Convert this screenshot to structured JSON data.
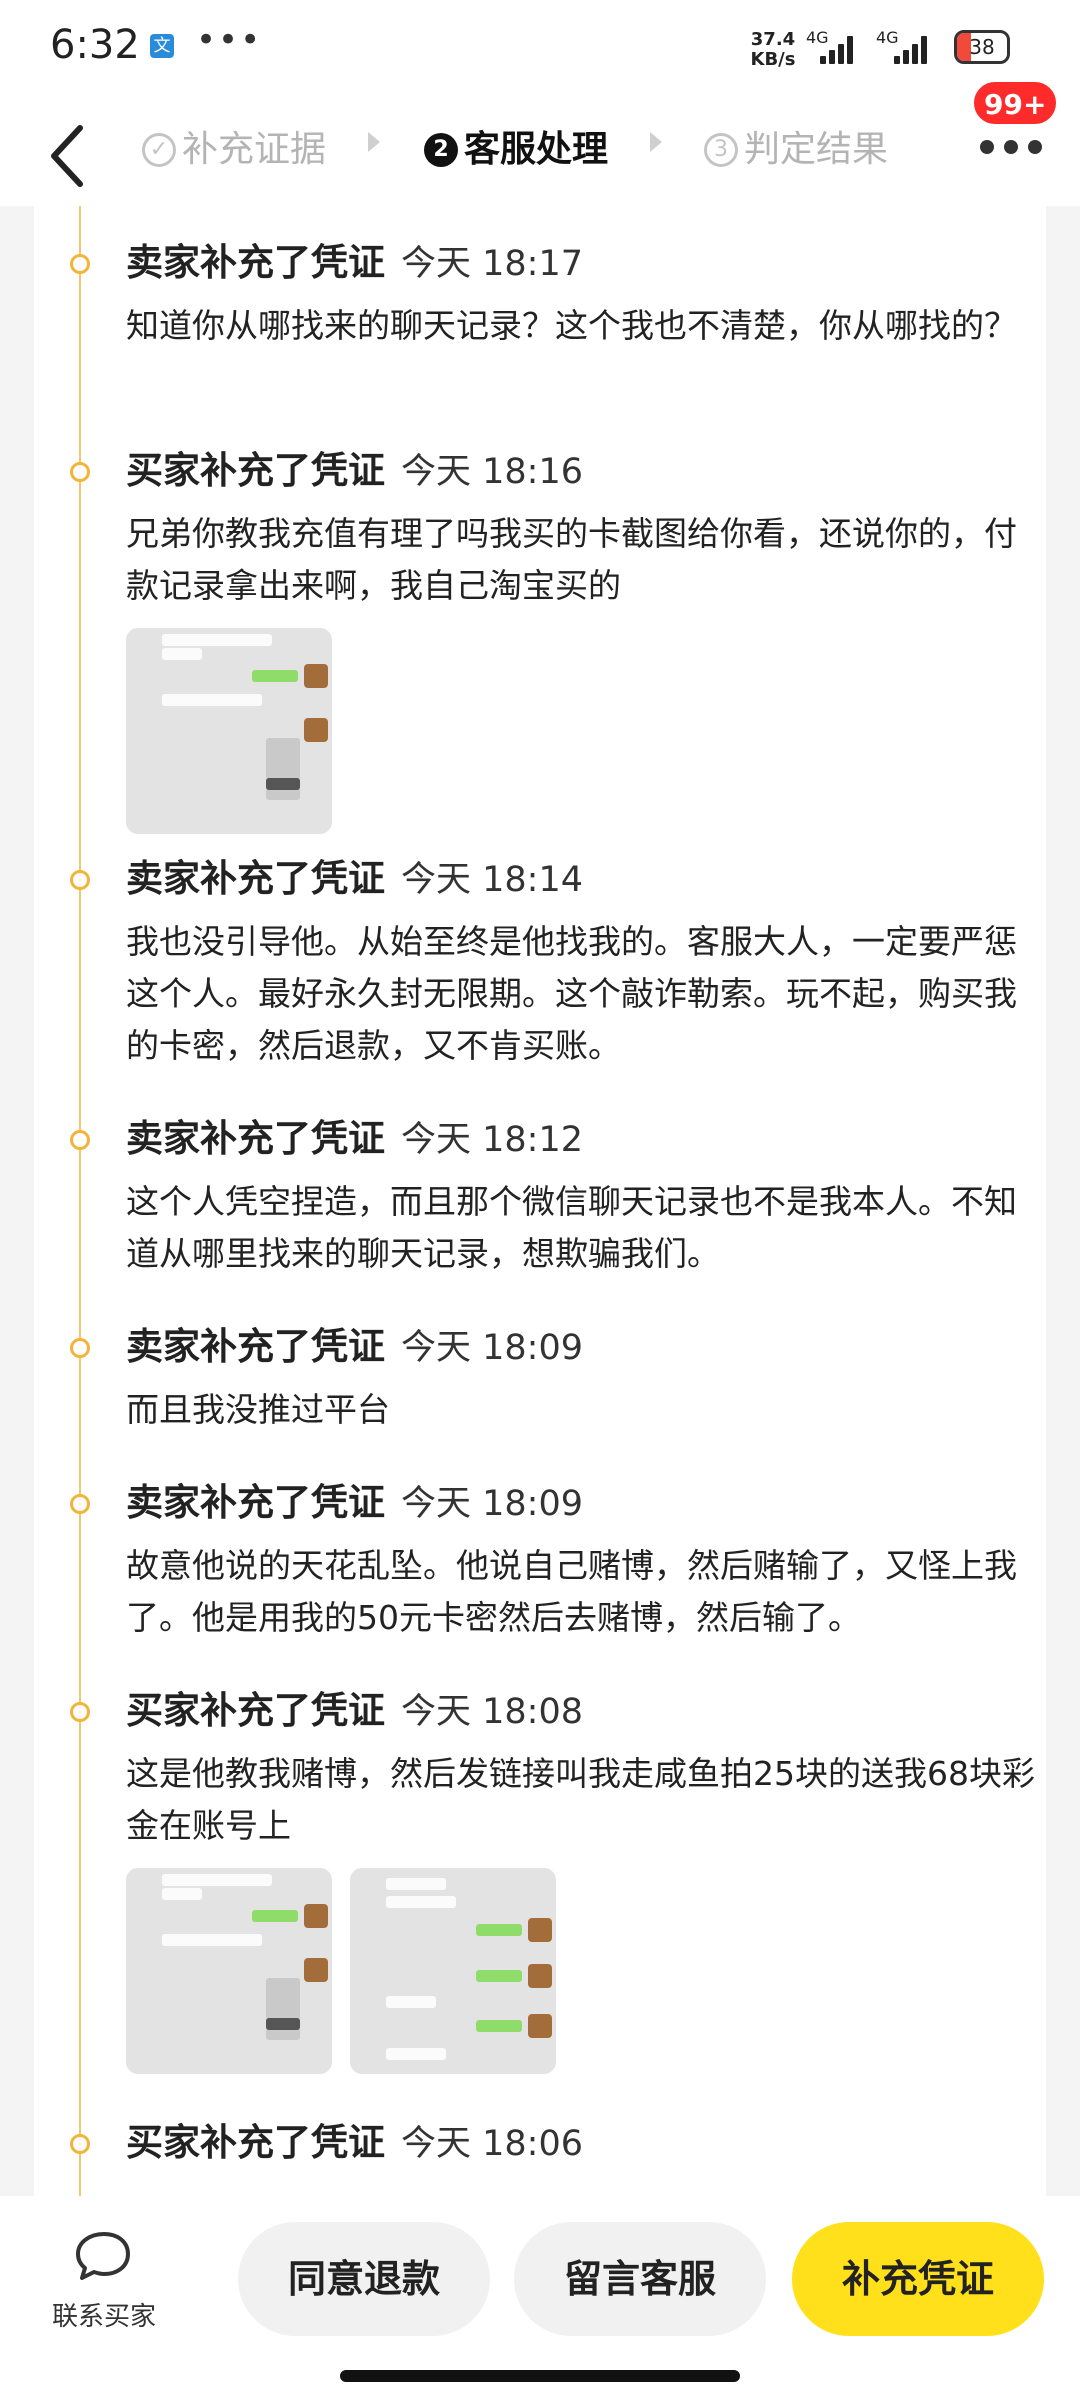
{
  "status_bar": {
    "time": "6:32",
    "app_icon_glyph": "文",
    "more_dots": "•••",
    "net_speed_value": "37.4",
    "net_speed_unit": "KB/s",
    "network_1": "4G",
    "network_2": "4G",
    "battery": "38"
  },
  "header": {
    "steps": [
      {
        "number": "✓",
        "label": "补充证据",
        "state": "done"
      },
      {
        "number": "2",
        "label": "客服处理",
        "state": "active"
      },
      {
        "number": "3",
        "label": "判定结果",
        "state": "pending"
      }
    ],
    "badge": "99+"
  },
  "timeline": [
    {
      "title": "卖家补充了凭证",
      "time": "今天 18:17",
      "text": "知道你从哪找来的聊天记录？这个我也不清楚，你从哪找的？"
    },
    {
      "title": "买家补充了凭证",
      "time": "今天 18:16",
      "text": "兄弟你教我充值有理了吗我买的卡截图给你看，还说你的，付款记录拿出来啊，我自己淘宝买的"
    },
    {
      "title": "卖家补充了凭证",
      "time": "今天 18:14",
      "text": "我也没引导他。从始至终是他找我的。客服大人，一定要严惩这个人。最好永久封无限期。这个敲诈勒索。玩不起，购买我的卡密，然后退款，又不肯买账。"
    },
    {
      "title": "卖家补充了凭证",
      "time": "今天 18:12",
      "text": "这个人凭空捏造，而且那个微信聊天记录也不是我本人。不知道从哪里找来的聊天记录，想欺骗我们。"
    },
    {
      "title": "卖家补充了凭证",
      "time": "今天 18:09",
      "text": "而且我没推过平台"
    },
    {
      "title": "卖家补充了凭证",
      "time": "今天 18:09",
      "text": "故意他说的天花乱坠。他说自己赌博，然后赌输了，又怪上我了。他是用我的50元卡密然后去赌博，然后输了。"
    },
    {
      "title": "买家补充了凭证",
      "time": "今天 18:08",
      "text": "这是他教我赌博，然后发链接叫我走咸鱼拍25块的送我68块彩金在账号上"
    },
    {
      "title": "买家补充了凭证",
      "time": "今天 18:06",
      "text": ""
    }
  ],
  "bottom": {
    "contact_label": "联系买家",
    "agree_refund": "同意退款",
    "message_service": "留言客服",
    "add_evidence": "补充凭证"
  },
  "colors": {
    "accent_yellow": "#ffe01a",
    "timeline_orange": "#f4b33a",
    "badge_red": "#ff2b2b"
  }
}
